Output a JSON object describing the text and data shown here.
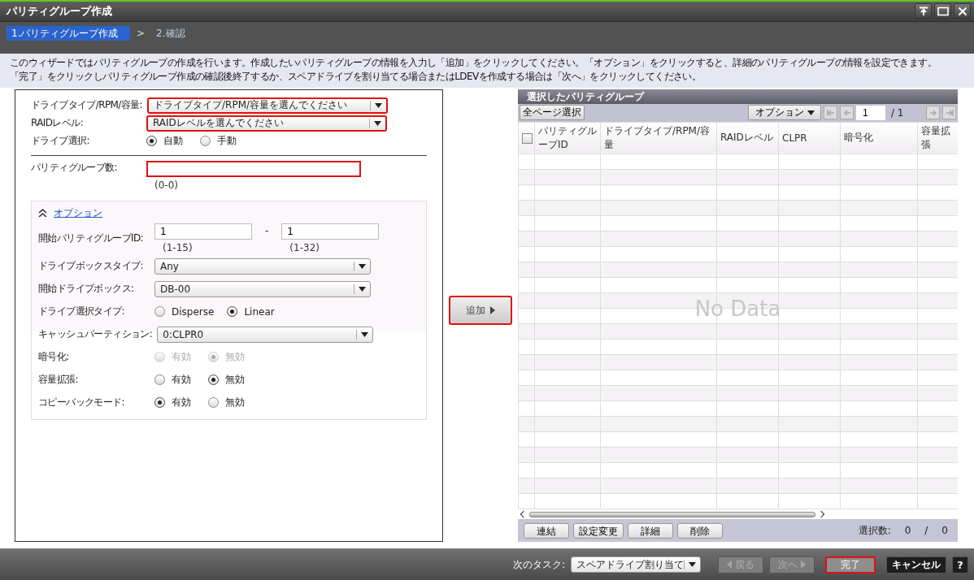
{
  "window": {
    "title": "パリティグループ作成"
  },
  "steps": [
    {
      "label": "1.パリティグループ作成",
      "selected": true
    },
    {
      "label": "2.確認",
      "selected": false
    }
  ],
  "step_separator": ">",
  "description": [
    "このウィザードではパリティグループの作成を行います。作成したいパリティグループの情報を入力し「追加」をクリックしてください。「オプション」をクリックすると、詳細のパリティグループの情報を設定できます。",
    "「完了」をクリックしパリティグループ作成の確認後終了するか、スペアドライブを割り当てる場合またはLDEVを作成する場合は「次へ」をクリックしてください。"
  ],
  "form": {
    "fields": [
      {
        "kind": "select",
        "label": "ドライブタイプ/RPM/容量:",
        "value": "ドライブタイプ/RPM/容量を選んでください",
        "highlighted": true
      },
      {
        "kind": "select",
        "label": "RAIDレベル:",
        "value": "RAIDレベルを選んでください",
        "highlighted": true
      },
      {
        "kind": "radio",
        "label": "ドライブ選択:",
        "disabled": false,
        "options": [
          {
            "label": "自動",
            "selected": true
          },
          {
            "label": "手動",
            "selected": false
          }
        ]
      }
    ],
    "count_field": {
      "label": "パリティグループ数:",
      "hint": "(0-0)",
      "highlighted": true
    }
  },
  "options": {
    "link": "オプション",
    "expanded": true,
    "fields": [
      {
        "kind": "range",
        "label": "開始パリティグループID:",
        "from": {
          "value": "1",
          "hint": "(1-15)"
        },
        "separator": "-",
        "to": {
          "value": "1",
          "hint": "(1-32)"
        }
      },
      {
        "kind": "select",
        "label": "ドライブボックスタイプ:",
        "value": "Any",
        "highlighted": false
      },
      {
        "kind": "select",
        "label": "開始ドライブボックス:",
        "value": "DB-00",
        "highlighted": false
      },
      {
        "kind": "radio",
        "label": "ドライブ選択タイプ:",
        "disabled": false,
        "options": [
          {
            "label": "Disperse",
            "selected": false
          },
          {
            "label": "Linear",
            "selected": true
          }
        ]
      },
      {
        "kind": "select",
        "label": "キャッシュパーティション:",
        "value": "0:CLPR0",
        "highlighted": false
      },
      {
        "kind": "radio",
        "label": "暗号化:",
        "disabled": true,
        "options": [
          {
            "label": "有効",
            "selected": false
          },
          {
            "label": "無効",
            "selected": true
          }
        ]
      },
      {
        "kind": "radio",
        "label": "容量拡張:",
        "disabled": false,
        "options": [
          {
            "label": "有効",
            "selected": false
          },
          {
            "label": "無効",
            "selected": true
          }
        ]
      },
      {
        "kind": "radio",
        "label": "コピーバックモード:",
        "disabled": false,
        "options": [
          {
            "label": "有効",
            "selected": true
          },
          {
            "label": "無効",
            "selected": false
          }
        ]
      }
    ]
  },
  "add_button": {
    "label": "追加",
    "highlighted": true
  },
  "selected_table": {
    "title": "選択したパリティグループ",
    "select_all_button": "全ページ選択",
    "options_button": "オプション",
    "page": "1",
    "page_total": "/ 1",
    "select_all_checked": false,
    "columns": [
      "パリティグループID",
      "ドライブタイプ/RPM/容量",
      "RAIDレベル",
      "CLPR",
      "暗号化",
      "容量拡張"
    ],
    "empty_text": "No Data",
    "actions": [
      "連結",
      "設定変更",
      "詳細",
      "削除"
    ],
    "selection_label": "選択数:",
    "selected_count": "0",
    "count_separator": "/",
    "total_count": "0"
  },
  "footer": {
    "next_task_label": "次のタスク:",
    "next_task": "スペアドライブ割り当て",
    "buttons": [
      {
        "kind": "back",
        "label": "戻る",
        "disabled": true,
        "highlighted": false
      },
      {
        "kind": "next",
        "label": "次へ",
        "disabled": true,
        "highlighted": false
      },
      {
        "kind": "finish",
        "label": "完了",
        "disabled": false,
        "highlighted": true
      },
      {
        "kind": "cancel",
        "label": "キャンセル",
        "disabled": false,
        "highlighted": false
      },
      {
        "kind": "help",
        "label": "?",
        "disabled": false,
        "highlighted": false
      }
    ]
  }
}
